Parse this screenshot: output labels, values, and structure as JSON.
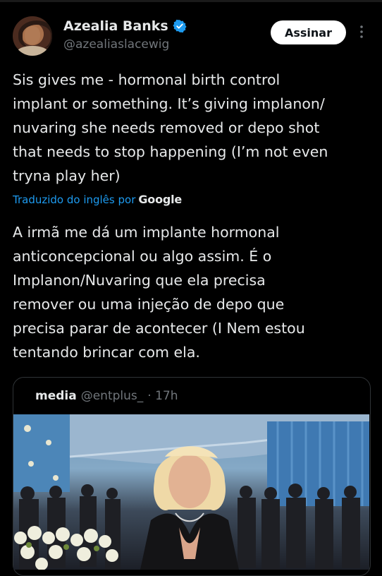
{
  "author": {
    "name": "Azealia Banks",
    "handle": "@azealiaslacewig",
    "verified": true
  },
  "follow_button": {
    "label": "Assinar"
  },
  "more_icon": "more-vertical-icon",
  "tweet": {
    "text": "Sis gives me -  hormonal birth control\nimplant or something. It’s giving implanon/\nnuvaring she needs removed or depo shot\nthat needs to stop happening (I’m not even\ntryna play her)"
  },
  "translation": {
    "label": "Traduzido do inglês por",
    "provider": "Google",
    "text": "A irmã me dá um implante hormonal\nanticoncepcional ou algo assim. É o\nImplanon/Nuvaring que ela precisa\nremover ou uma injeção de depo que\nprecisa parar de acontecer (I Nem estou\ntentando brincar com ela."
  },
  "quoted_tweet": {
    "name": "media",
    "handle": "@entplus_",
    "time": "· 17h"
  },
  "colors": {
    "background": "#000000",
    "text": "#e7e9ea",
    "muted": "#71767b",
    "accent": "#1d9bf0",
    "border": "#2f3336"
  }
}
